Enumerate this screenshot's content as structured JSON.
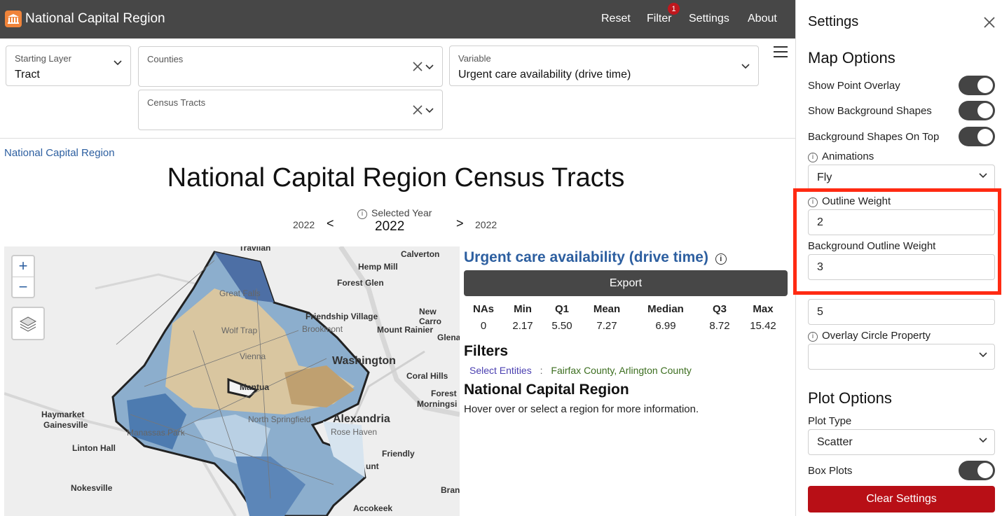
{
  "header": {
    "title": "National Capital Region",
    "nav": [
      "Reset",
      "Filter",
      "Settings",
      "About"
    ],
    "filter_badge": "1",
    "brand_color": "#f0843a"
  },
  "controls": {
    "starting_layer": {
      "label": "Starting Layer",
      "value": "Tract"
    },
    "counties": {
      "label": "Counties"
    },
    "census_tracts": {
      "label": "Census Tracts"
    },
    "variable": {
      "label": "Variable",
      "value": "Urgent care availability (drive time)"
    }
  },
  "breadcrumb": "National Capital Region",
  "page_title": "National Capital Region Census Tracts",
  "year_selector": {
    "label": "Selected Year",
    "value": "2022",
    "prev_year": "2022",
    "next_year": "2022",
    "prev_arrow": "<",
    "next_arrow": ">"
  },
  "map": {
    "zoom_in": "+",
    "zoom_out": "−",
    "place_labels": [
      "Travilah",
      "Calverton",
      "Hemp Mill",
      "Forest Glen",
      "Great Falls",
      "Friendship Village",
      "New Carro",
      "Brookmont",
      "Mount Rainier",
      "Wolf Trap",
      "Glena",
      "Vienna",
      "Washington",
      "Coral Hills",
      "Mantua",
      "Forest",
      "Morningsi",
      "Haymarket",
      "Gainesville",
      "Alexandria",
      "North Springfield",
      "Manassas Park",
      "Rose Haven",
      "Friendly",
      "Linton Hall",
      "unt",
      "Nokesville",
      "Bran",
      "Accokeek"
    ]
  },
  "info": {
    "variable_title": "Urgent care availability (drive time)",
    "export_label": "Export",
    "stats_headers": [
      "NAs",
      "Min",
      "Q1",
      "Mean",
      "Median",
      "Q3",
      "Max"
    ],
    "stats_values": [
      "0",
      "2.17",
      "5.50",
      "7.27",
      "6.99",
      "8.72",
      "15.42"
    ],
    "filters_heading": "Filters",
    "filter_key": "Select Entities",
    "filter_value": "Fairfax County, Arlington County",
    "region_heading": "National Capital Region",
    "region_text": "Hover over or select a region for more information."
  },
  "settings": {
    "title": "Settings",
    "map_options_heading": "Map Options",
    "show_point_overlay": "Show Point Overlay",
    "show_background_shapes": "Show Background Shapes",
    "background_shapes_on_top": "Background Shapes On Top",
    "animations_label": "Animations",
    "animations_value": "Fly",
    "outline_weight_label": "Outline Weight",
    "outline_weight_value": "2",
    "background_outline_weight_label": "Background Outline Weight",
    "background_outline_weight_value": "3",
    "overlay_circle_size_value": "5",
    "overlay_circle_property_label": "Overlay Circle Property",
    "plot_options_heading": "Plot Options",
    "plot_type_label": "Plot Type",
    "plot_type_value": "Scatter",
    "box_plots_label": "Box Plots",
    "clear_settings_label": "Clear Settings"
  }
}
